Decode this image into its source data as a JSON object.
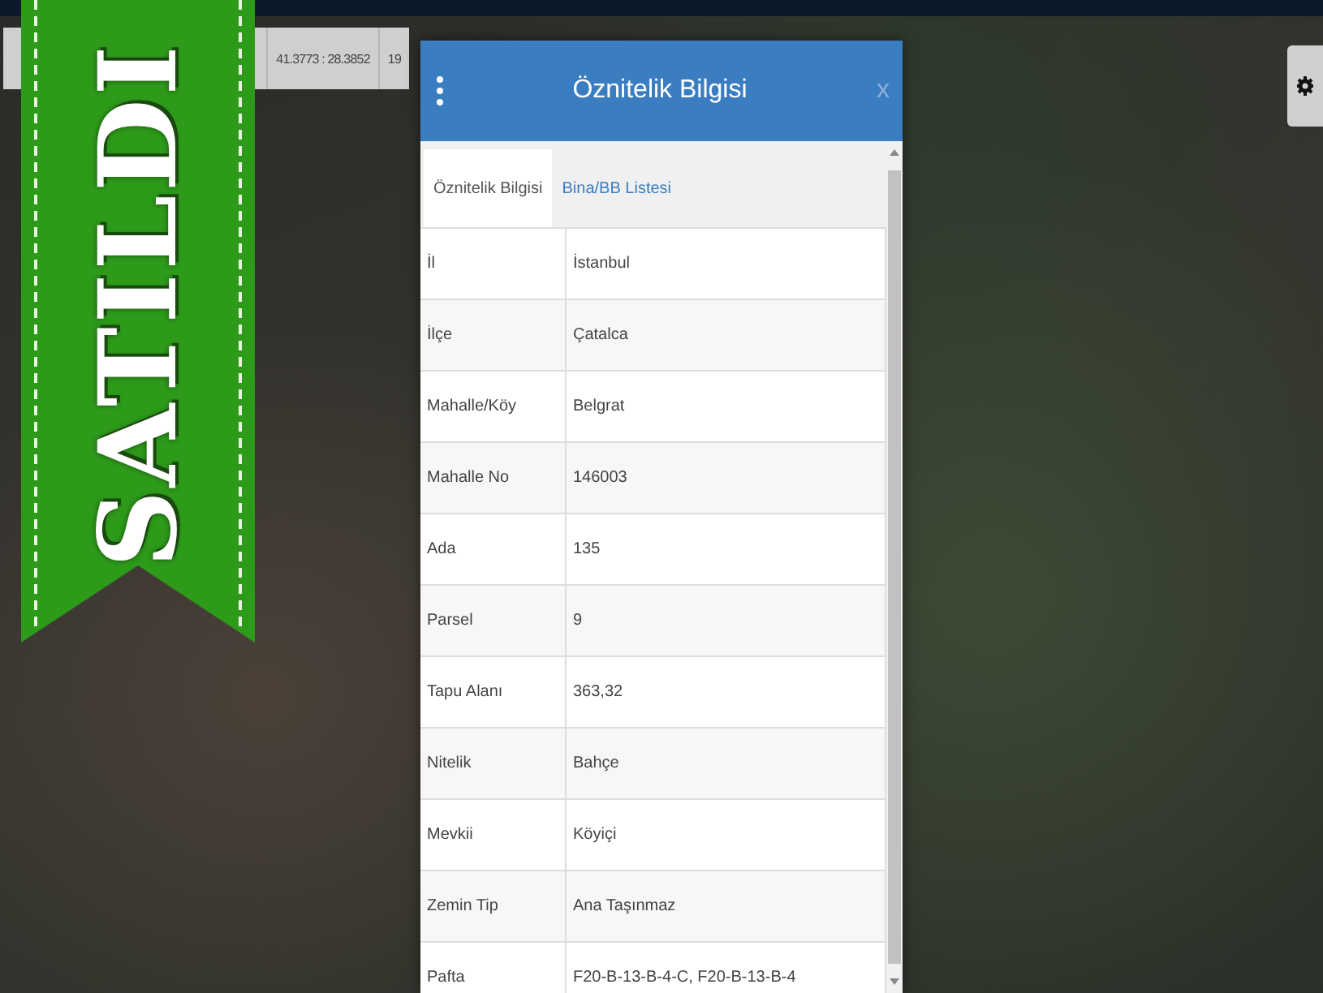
{
  "map_toolbar": {
    "coordinates": "41.3773 : 28.3852",
    "zoom_level": "19"
  },
  "ribbon": {
    "text": "SATILDI"
  },
  "dialog": {
    "title": "Öznitelik Bilgisi",
    "close": "x",
    "tabs": [
      {
        "label": "Öznitelik Bilgisi",
        "selected": true
      },
      {
        "label": "Bina/BB Listesi",
        "selected": false
      }
    ],
    "rows": [
      {
        "label": "İl",
        "value": "İstanbul"
      },
      {
        "label": "İlçe",
        "value": "Çatalca"
      },
      {
        "label": "Mahalle/Köy",
        "value": "Belgrat"
      },
      {
        "label": "Mahalle No",
        "value": "146003"
      },
      {
        "label": "Ada",
        "value": "135"
      },
      {
        "label": "Parsel",
        "value": "9"
      },
      {
        "label": "Tapu Alanı",
        "value": "363,32"
      },
      {
        "label": "Nitelik",
        "value": "Bahçe"
      },
      {
        "label": "Mevkii",
        "value": "Köyiçi"
      },
      {
        "label": "Zemin Tip",
        "value": "Ana Taşınmaz"
      },
      {
        "label": "Pafta",
        "value": "F20-B-13-B-4-C, F20-B-13-B-4"
      }
    ]
  }
}
